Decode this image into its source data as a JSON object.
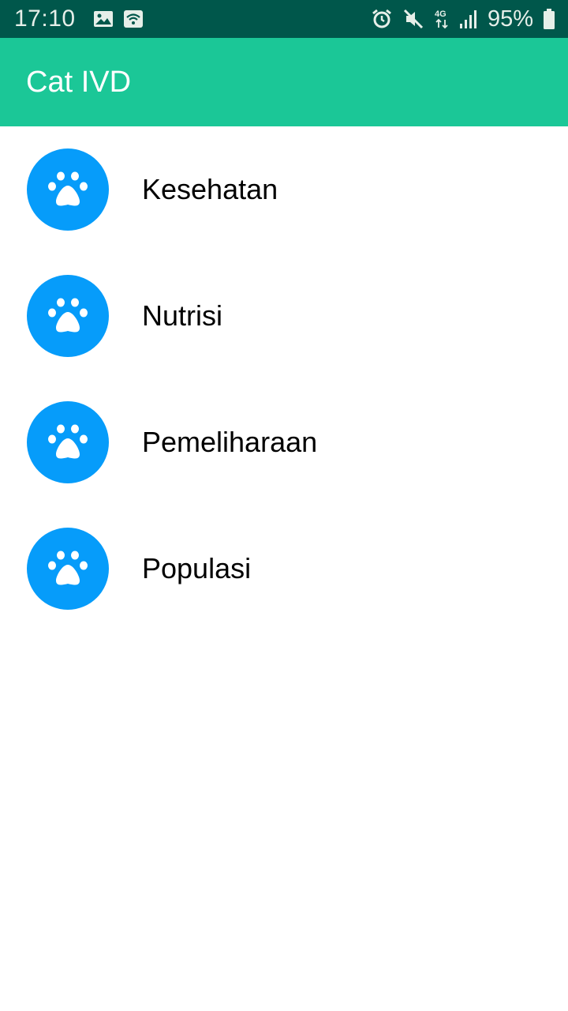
{
  "status_bar": {
    "time": "17:10",
    "battery": "95%",
    "network": "4G",
    "icons": [
      "image-icon",
      "wifi-hotspot-icon",
      "alarm-icon",
      "mute-icon",
      "network-4g-icon",
      "signal-icon",
      "battery-icon"
    ]
  },
  "app_bar": {
    "title": "Cat IVD",
    "color": "#1bc797"
  },
  "list": {
    "icon": "paw-icon",
    "icon_bg": "#069cfa",
    "items": [
      {
        "label": "Kesehatan"
      },
      {
        "label": "Nutrisi"
      },
      {
        "label": "Pemeliharaan"
      },
      {
        "label": "Populasi"
      }
    ]
  }
}
